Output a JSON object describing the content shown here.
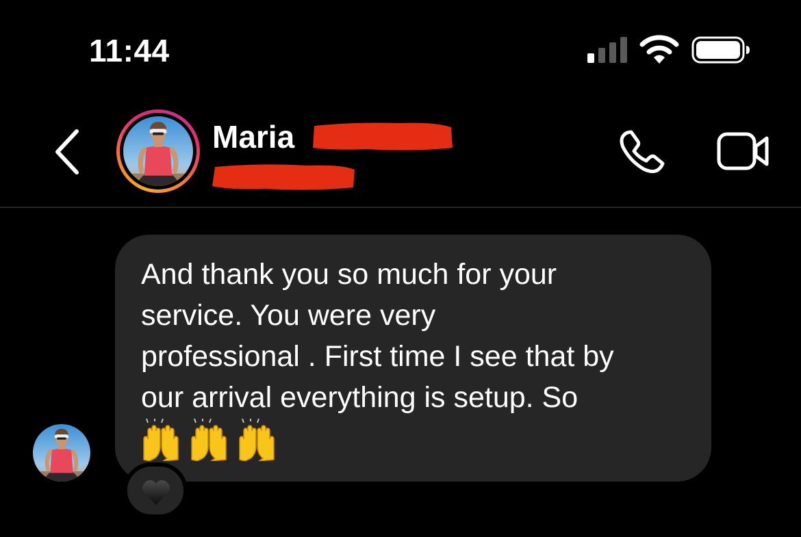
{
  "status_bar": {
    "time": "11:44",
    "signal_icon": "cellular-signal-icon",
    "wifi_icon": "wifi-icon",
    "battery_icon": "battery-icon"
  },
  "header": {
    "back_icon": "chevron-left-icon",
    "contact_name": "Maria",
    "call_icon": "phone-icon",
    "video_icon": "video-camera-icon",
    "story_ring_colors": [
      "#f9a825",
      "#e1306c",
      "#c13584"
    ],
    "redaction_color": "#e52d14"
  },
  "messages": [
    {
      "direction": "incoming",
      "text": "And thank you so much for your\nservice. You were very\nprofessional . First time I see that by\nour arrival everything is setup. So",
      "emoji": "🙌🙌🙌",
      "emoji_icon": "raising-hands-emoji",
      "reaction": "🖤",
      "reaction_icon": "black-heart-icon"
    }
  ],
  "colors": {
    "background": "#000000",
    "bubble": "#262626",
    "text": "#ffffff"
  }
}
